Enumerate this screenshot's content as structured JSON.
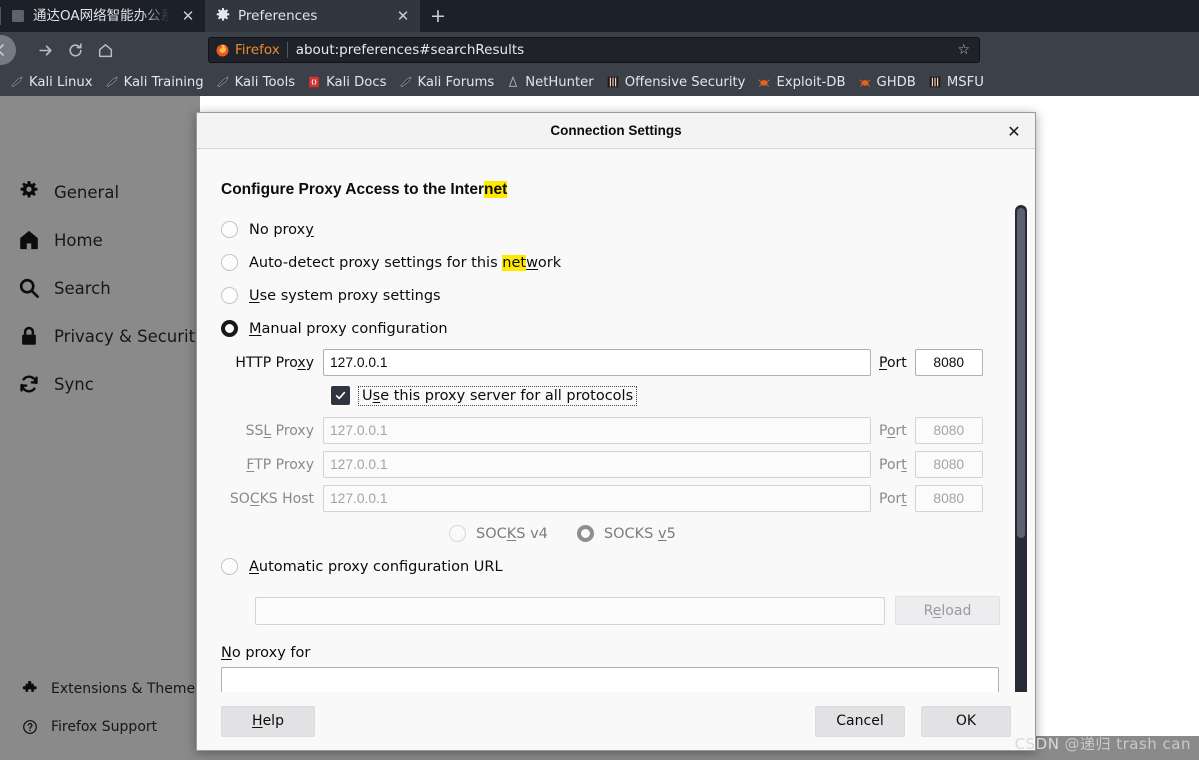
{
  "browser": {
    "tabs": [
      {
        "title": "通达OA网络智能办公系统",
        "favicon": "page-icon",
        "active": false
      },
      {
        "title": "Preferences",
        "favicon": "gear-icon",
        "active": true
      }
    ],
    "new_tab_label": "+",
    "close_label": "✕",
    "nav": {
      "back_label": "←",
      "forward_label": "→",
      "reload_label": "⟳",
      "home_label": "⌂"
    },
    "urlbar": {
      "brand": "Firefox",
      "url": "about:preferences#searchResults",
      "star_label": "☆"
    },
    "toolbar_right": [
      {
        "name": "downloads-icon"
      },
      {
        "name": "library-icon"
      },
      {
        "name": "sidebar-toggle-icon"
      },
      {
        "name": "account-icon"
      }
    ],
    "bookmarks": [
      {
        "label": "Kali Linux",
        "icon": "dragon-icon"
      },
      {
        "label": "Kali Training",
        "icon": "dragon-icon"
      },
      {
        "label": "Kali Tools",
        "icon": "dragon-icon"
      },
      {
        "label": "Kali Docs",
        "icon": "book-icon"
      },
      {
        "label": "Kali Forums",
        "icon": "dragon-icon"
      },
      {
        "label": "NetHunter",
        "icon": "nethunter-icon"
      },
      {
        "label": "Offensive Security",
        "icon": "offsec-icon"
      },
      {
        "label": "Exploit-DB",
        "icon": "bug-icon"
      },
      {
        "label": "GHDB",
        "icon": "bug-icon"
      },
      {
        "label": "MSFU",
        "icon": "offsec-icon"
      }
    ]
  },
  "preferences": {
    "sidebar": [
      {
        "label": "General",
        "icon": "gear-icon"
      },
      {
        "label": "Home",
        "icon": "home-icon"
      },
      {
        "label": "Search",
        "icon": "search-icon"
      },
      {
        "label": "Privacy & Security",
        "icon": "lock-icon"
      },
      {
        "label": "Sync",
        "icon": "sync-icon"
      }
    ],
    "sidebar_bottom": [
      {
        "label": "Extensions & Themes",
        "icon": "puzzle-icon"
      },
      {
        "label": "Firefox Support",
        "icon": "question-circle-icon"
      }
    ]
  },
  "dialog": {
    "title": "Connection Settings",
    "close_label": "✕",
    "heading_pre": "Configure Proxy Access to the Inter",
    "heading_highlight": "net",
    "options": [
      {
        "label": "No prox",
        "accesskey": "y",
        "suffix": "",
        "selected": false
      },
      {
        "label": "Auto-detect proxy settings for this ",
        "highlight": "net",
        "accesskey": "w",
        "suffix": "ork",
        "selected": false
      },
      {
        "label": "Use system proxy settings",
        "accesskey": "U",
        "selected": false
      },
      {
        "label": "Manual proxy configuration",
        "accesskey": "M",
        "selected": true
      },
      {
        "label": "Automatic proxy configuration URL",
        "accesskey": "A",
        "selected": false
      }
    ],
    "option_labels": {
      "no_proxy": "No proxy",
      "auto_detect": "Auto-detect proxy settings for this network",
      "use_system": "Use system proxy settings",
      "manual": "Manual proxy configuration",
      "pac": "Automatic proxy configuration URL"
    },
    "fields": [
      {
        "label": "HTTP Proxy",
        "value": "127.0.0.1",
        "port_label": "Port",
        "port": "8080",
        "disabled": false
      },
      {
        "label": "SSL Proxy",
        "value": "127.0.0.1",
        "port_label": "Port",
        "port": "8080",
        "disabled": true
      },
      {
        "label": "FTP Proxy",
        "value": "127.0.0.1",
        "port_label": "Port",
        "port": "8080",
        "disabled": true
      },
      {
        "label": "SOCKS Host",
        "value": "127.0.0.1",
        "port_label": "Port",
        "port": "8080",
        "disabled": true
      }
    ],
    "use_all_protocols": {
      "label": "Use this proxy server for all protocols",
      "checked": true
    },
    "socks": {
      "v4_label": "SOCKS v4",
      "v5_label": "SOCKS v5",
      "selected": "v5",
      "disabled": true
    },
    "pac": {
      "url_value": "",
      "reload_label": "Reload",
      "disabled": true
    },
    "no_proxy_for": {
      "label": "No proxy for",
      "value": ""
    },
    "buttons": {
      "help": "Help",
      "cancel": "Cancel",
      "ok": "OK"
    }
  },
  "watermark": {
    "brand": "CSDN",
    "user": "@递归 trash can"
  },
  "colors": {
    "chrome_dark": "#3b4049",
    "tabbar_dark": "#1c2028",
    "accent_orange": "#e88b2f",
    "highlight_yellow": "#ffe900",
    "dialog_bg": "#f9f9fa"
  }
}
